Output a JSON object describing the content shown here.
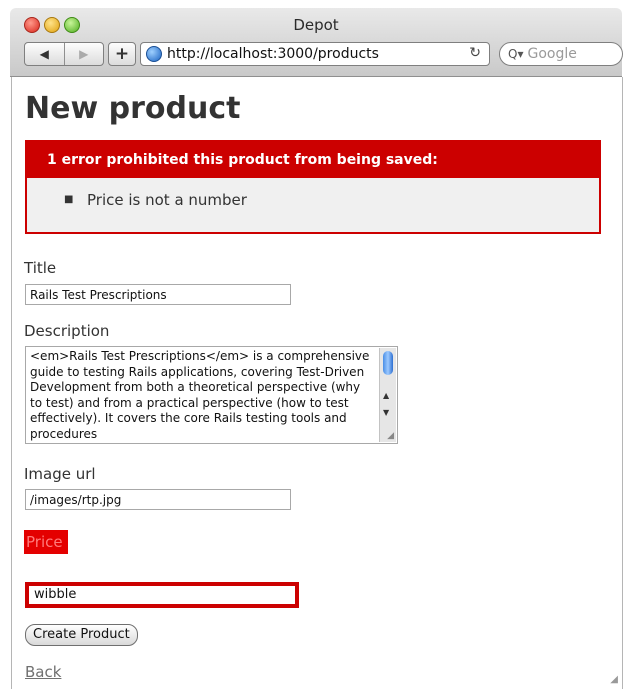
{
  "window": {
    "title": "Depot",
    "url": "http://localhost:3000/products",
    "search_placeholder": "Google"
  },
  "toolbar": {
    "back_glyph": "◀",
    "forward_glyph": "▶",
    "add_glyph": "+",
    "reload_glyph": "↻",
    "search_glyph": "Q▾"
  },
  "page": {
    "heading": "New product",
    "error_header": "1 error prohibited this product from being saved:",
    "errors": [
      "Price is not a number"
    ],
    "title_label": "Title",
    "title_value": "Rails Test Prescriptions",
    "description_label": "Description",
    "description_value": "<em>Rails Test Prescriptions</em> is a comprehensive guide to testing Rails applications, covering Test-Driven Development from both a theoretical perspective (why to test) and from a practical perspective (how to test effectively). It covers the core Rails testing tools and procedures",
    "image_url_label": "Image url",
    "image_url_value": "/images/rtp.jpg",
    "price_label": "Price",
    "price_value": "wibble",
    "create_button": "Create Product",
    "back_link": "Back"
  },
  "colors": {
    "error_red": "#cc0000",
    "error_box_bg": "#f0f0f0",
    "text": "#333333"
  },
  "icons": {
    "globe": "globe-icon",
    "reload": "reload-icon",
    "search": "search-icon"
  }
}
